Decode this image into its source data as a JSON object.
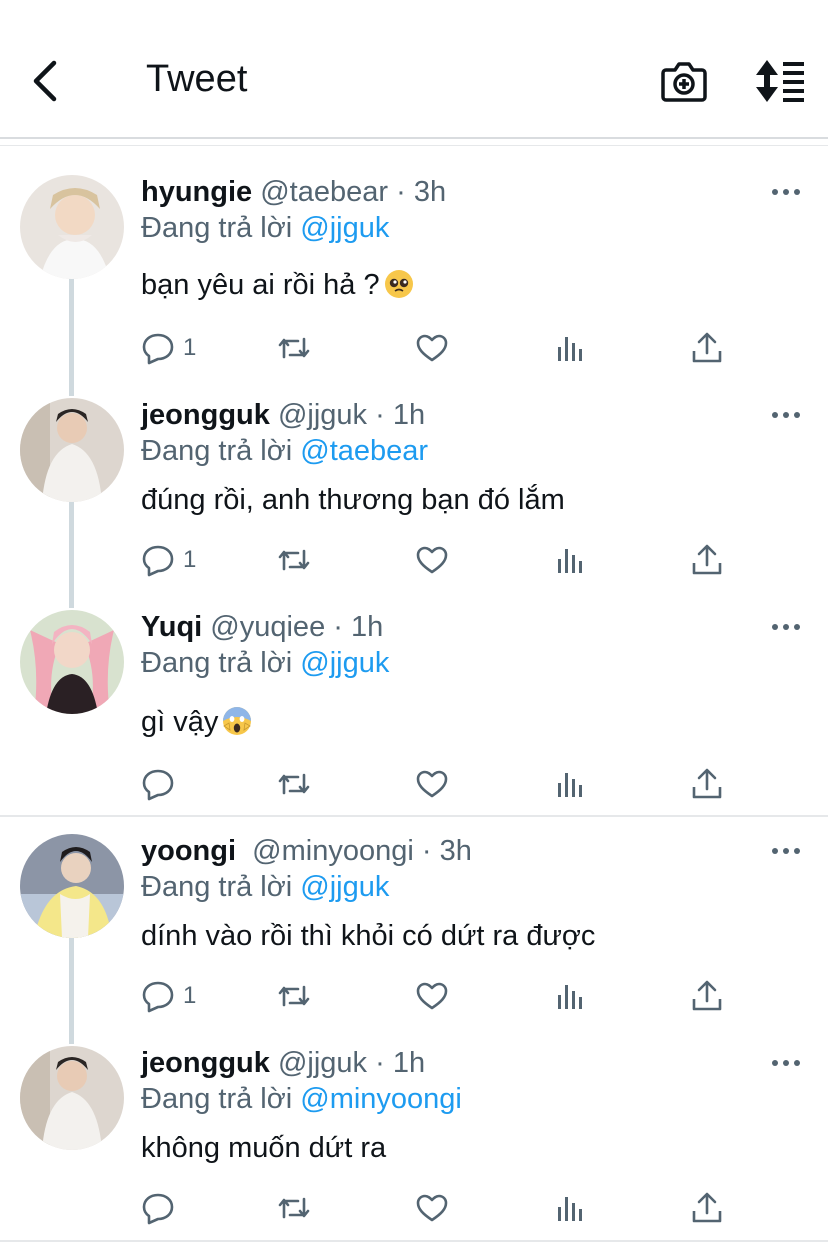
{
  "header": {
    "title": "Tweet",
    "back_icon": "chevron-left-icon",
    "camera_icon": "camera-icon",
    "sort_icon": "sort-icon"
  },
  "colors": {
    "mention": "#1d9bf0",
    "secondary_text": "#536471",
    "primary_text": "#0f1419",
    "thread_line": "#cfd9de"
  },
  "tweets": [
    {
      "name": "hyungie",
      "handle": "@taebear",
      "sep": " · ",
      "time": "3h",
      "reply_prefix": "Đang trả lời ",
      "reply_to": "@jjguk",
      "text": "bạn yêu ai rồi hả ?",
      "emoji": "pleading-face-emoji",
      "reply_count": "1"
    },
    {
      "name": "jeongguk",
      "handle": "@jjguk",
      "sep": " · ",
      "time": "1h",
      "reply_prefix": "Đang trả lời ",
      "reply_to": "@taebear",
      "text": "đúng rồi, anh thương bạn đó lắm",
      "emoji": "",
      "reply_count": "1"
    },
    {
      "name": "Yuqi",
      "handle": "@yuqiee",
      "sep": " · ",
      "time": "1h",
      "reply_prefix": "Đang trả lời ",
      "reply_to": "@jjguk",
      "text": "gì vậy",
      "emoji": "screaming-face-emoji",
      "reply_count": ""
    },
    {
      "name": "yoongi",
      "handle": "@minyoongi",
      "sep": " · ",
      "time": "3h",
      "reply_prefix": "Đang trả lời ",
      "reply_to": "@jjguk",
      "text": "dính vào rồi thì khỏi có dứt ra được",
      "emoji": "",
      "reply_count": "1"
    },
    {
      "name": "jeongguk",
      "handle": "@jjguk",
      "sep": " · ",
      "time": "1h",
      "reply_prefix": "Đang trả lời ",
      "reply_to": "@minyoongi",
      "text": "không muốn dứt ra",
      "emoji": "",
      "reply_count": ""
    }
  ]
}
